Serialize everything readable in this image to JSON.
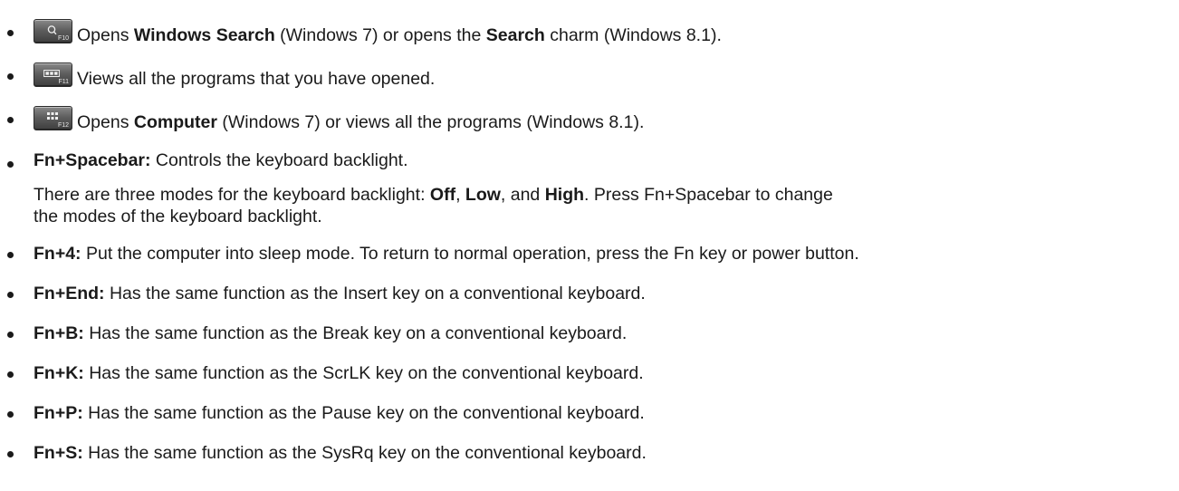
{
  "items": [
    {
      "key_label": "F10",
      "key_icon": "search-icon",
      "parts": [
        "Opens ",
        "Windows Search",
        " (Windows 7) or opens the ",
        "Search",
        " charm (Windows 8.1)."
      ]
    },
    {
      "key_label": "F11",
      "key_icon": "program-switcher-icon",
      "parts": [
        "Views all the programs that you have opened."
      ]
    },
    {
      "key_label": "F12",
      "key_icon": "apps-grid-icon",
      "parts": [
        "Opens ",
        "Computer",
        " (Windows 7) or views all the programs (Windows 8.1)."
      ]
    },
    {
      "bold": "Fn+Spacebar:",
      "text": " Controls the keyboard backlight.",
      "sub": {
        "line1": [
          "There are three modes for the keyboard backlight: ",
          "Off",
          ", ",
          "Low",
          ", and ",
          "High",
          ". Press Fn+Spacebar to change"
        ],
        "line2": "the modes of the keyboard backlight."
      }
    },
    {
      "bold": "Fn+4:",
      "text": " Put the computer into sleep mode. To return to normal operation, press the Fn key or power button."
    },
    {
      "bold": "Fn+End:",
      "text": " Has the same function as the Insert key on a conventional keyboard."
    },
    {
      "bold": "Fn+B:",
      "text": " Has the same function as the Break key on a conventional keyboard."
    },
    {
      "bold": "Fn+K:",
      "text": " Has the same function as the ScrLK key on the conventional keyboard."
    },
    {
      "bold": "Fn+P:",
      "text": " Has the same function as the Pause key on the conventional keyboard."
    },
    {
      "bold": "Fn+S:",
      "text": " Has the same function as the SysRq key on the conventional keyboard."
    }
  ]
}
